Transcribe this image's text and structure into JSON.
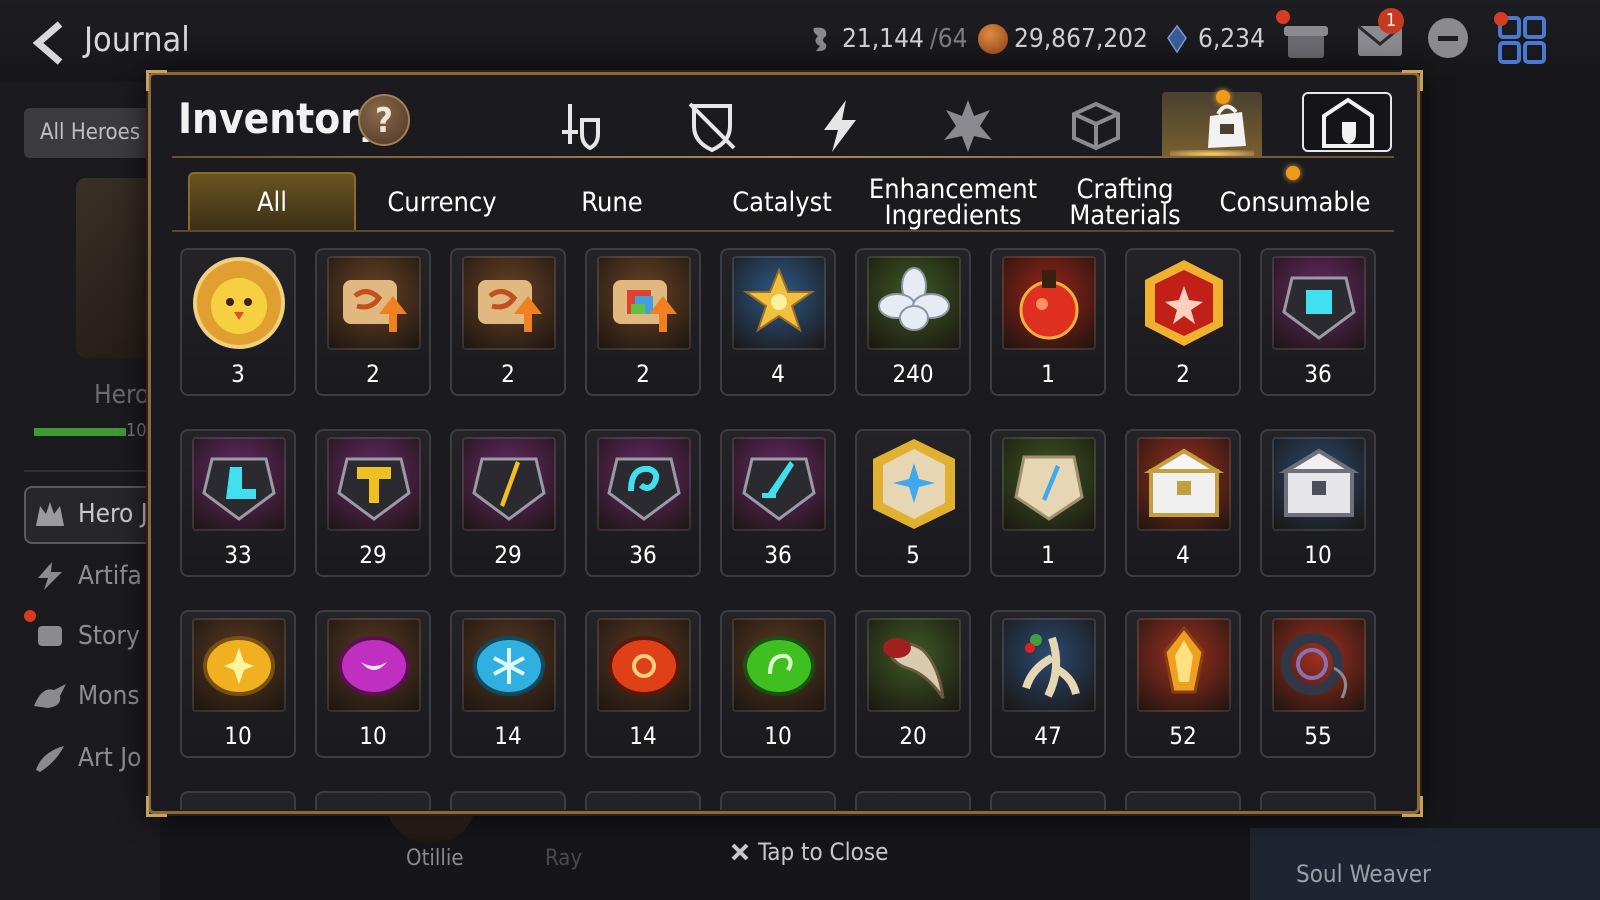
{
  "header": {
    "title": "Journal",
    "stamina_value": "21,144",
    "stamina_cap": "/64",
    "gold": "29,867,202",
    "crystals": "6,234",
    "mail_badge": "1"
  },
  "background": {
    "filter_label": "All Heroes",
    "hero_label": "Hero",
    "bar_label": "10",
    "sidebar": [
      "Hero J",
      "Artifa",
      "Story",
      "Mons",
      "Art Jo"
    ],
    "bottom_names": [
      "Otillie",
      "Ray"
    ],
    "right_label": "Soul Weaver"
  },
  "modal": {
    "title": "Inventory",
    "help_label": "?",
    "category_icons": [
      "hero-gear-icon",
      "no-gear-icon",
      "artifact-icon",
      "rune-icon",
      "cube-icon",
      "bag-icon",
      "house-icon"
    ],
    "tabs": [
      {
        "line1": "All",
        "line2": ""
      },
      {
        "line1": "Currency",
        "line2": ""
      },
      {
        "line1": "Rune",
        "line2": ""
      },
      {
        "line1": "Catalyst",
        "line2": ""
      },
      {
        "line1": "Enhancement",
        "line2": "Ingredients"
      },
      {
        "line1": "Crafting",
        "line2": "Materials"
      },
      {
        "line1": "Consumable",
        "line2": ""
      }
    ],
    "items": [
      {
        "icon": "chick-token",
        "count": "3",
        "bg": "#b07a30"
      },
      {
        "icon": "scroll-up",
        "count": "2",
        "bg": "#6a4326"
      },
      {
        "icon": "scroll-up",
        "count": "2",
        "bg": "#6a4326"
      },
      {
        "icon": "scroll-rainbow",
        "count": "2",
        "bg": "#6a4326"
      },
      {
        "icon": "gold-flower",
        "count": "4",
        "bg": "#2c5a8a"
      },
      {
        "icon": "silver-flower",
        "count": "240",
        "bg": "#3d5a24"
      },
      {
        "icon": "red-potion",
        "count": "1",
        "bg": "#9a2418"
      },
      {
        "icon": "red-gem-hex",
        "count": "2",
        "bg": "#b02418"
      },
      {
        "icon": "armor-stone",
        "count": "36",
        "bg": "#6a2a6a"
      },
      {
        "icon": "boot-stone",
        "count": "33",
        "bg": "#6a2a6a"
      },
      {
        "icon": "hammer-stone",
        "count": "29",
        "bg": "#6a2a6a"
      },
      {
        "icon": "blade-stone",
        "count": "29",
        "bg": "#6a2a6a"
      },
      {
        "icon": "swirl-stone",
        "count": "36",
        "bg": "#6a2a6a"
      },
      {
        "icon": "sword-stone",
        "count": "36",
        "bg": "#6a2a6a"
      },
      {
        "icon": "star-stone-hex",
        "count": "5",
        "bg": "#1f3a2a"
      },
      {
        "icon": "tablet-stone",
        "count": "1",
        "bg": "#3d5a24"
      },
      {
        "icon": "gold-chest",
        "count": "4",
        "bg": "#a03020"
      },
      {
        "icon": "silver-chest",
        "count": "10",
        "bg": "#2a4a70"
      },
      {
        "icon": "yellow-rune",
        "count": "10",
        "bg": "#5a3a22"
      },
      {
        "icon": "purple-rune",
        "count": "10",
        "bg": "#5a3a22"
      },
      {
        "icon": "cyan-rune",
        "count": "14",
        "bg": "#5a3a22"
      },
      {
        "icon": "red-rune",
        "count": "14",
        "bg": "#5a3a22"
      },
      {
        "icon": "green-rune",
        "count": "10",
        "bg": "#5a3a22"
      },
      {
        "icon": "claw",
        "count": "20",
        "bg": "#3d5a24"
      },
      {
        "icon": "ginseng",
        "count": "47",
        "bg": "#2a4a70"
      },
      {
        "icon": "flame-crystal",
        "count": "52",
        "bg": "#a03020"
      },
      {
        "icon": "ring-coil",
        "count": "55",
        "bg": "#a03020"
      }
    ],
    "close_hint": "Tap to Close"
  },
  "colors": {
    "accent_gold": "#c9a15e",
    "notification": "#d93a22",
    "badge_orange": "#f09a18"
  }
}
